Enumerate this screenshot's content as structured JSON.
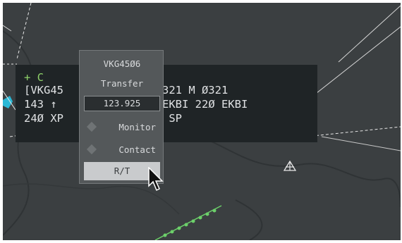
{
  "label": {
    "line0": "+ C",
    "line1": "[VKG45",
    "line1_tail": "A321 M Ø321",
    "line2": "143 ↑",
    "line2_tail": "7 EKBI 22Ø EKBI",
    "line3": "24Ø XP",
    "line3_tail": "SP"
  },
  "menu": {
    "callsign": "VKG45Ø6",
    "transfer": "Transfer",
    "frequency": "123.925",
    "monitor": "Monitor",
    "contact": "Contact",
    "rt": "R/T"
  },
  "colors": {
    "radar_bg": "#3b3f41",
    "label_bg": "#1f2426",
    "menu_bg": "#54585a",
    "track_green": "#6cd06a",
    "highlight": "#c9cbcd"
  },
  "icons": [
    "triangle-symbol-icon",
    "mouse-cursor-icon",
    "diamond-icon"
  ]
}
